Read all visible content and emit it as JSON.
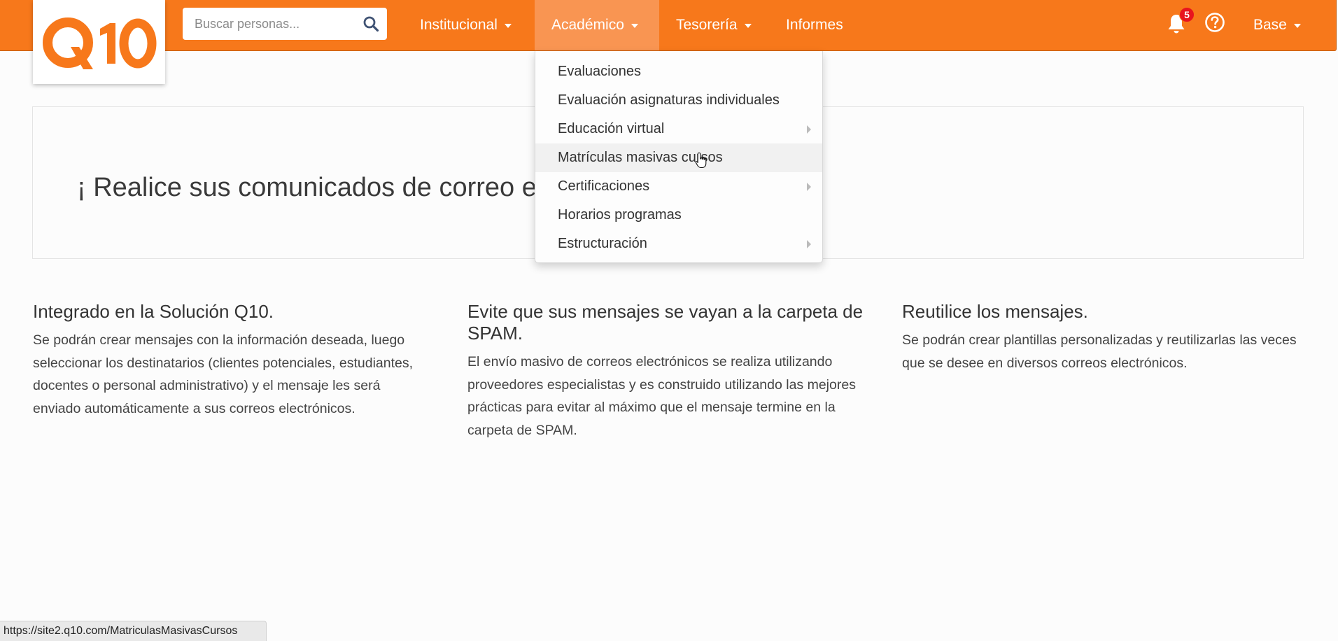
{
  "brand": {
    "logo_text": "Q10",
    "accent": "#f7781b",
    "hover_nav": "#f99552"
  },
  "search": {
    "placeholder": "Buscar personas...",
    "icon": "search-icon"
  },
  "nav": {
    "items": [
      {
        "label": "Institucional",
        "has_caret": true
      },
      {
        "label": "Académico",
        "has_caret": true,
        "active": true
      },
      {
        "label": "Tesorería",
        "has_caret": true
      },
      {
        "label": "Informes",
        "has_caret": false
      }
    ],
    "notifications": {
      "icon": "bell-icon",
      "count": "5"
    },
    "help_icon": "question-circle-icon",
    "user_label": "Base"
  },
  "dropdown": {
    "items": [
      {
        "label": "Evaluaciones",
        "submenu": false
      },
      {
        "label": "Evaluación asignaturas individuales",
        "submenu": false
      },
      {
        "label": "Educación virtual",
        "submenu": true
      },
      {
        "label": "Matrículas masivas cursos",
        "submenu": false,
        "hovered": true
      },
      {
        "label": "Certificaciones",
        "submenu": true
      },
      {
        "label": "Horarios programas",
        "submenu": false
      },
      {
        "label": "Estructuración",
        "submenu": true
      }
    ]
  },
  "hero": {
    "text": "¡ Realice sus comunicados de correo ele"
  },
  "features": [
    {
      "title": "Integrado en la Solución Q10.",
      "body": "Se podrán crear mensajes con la información deseada, luego seleccionar los destinatarios (clientes potenciales, estudiantes, docentes o personal administrativo) y el mensaje les será enviado automáticamente a sus correos electrónicos."
    },
    {
      "title": "Evite que sus mensajes se vayan a la carpeta de SPAM.",
      "body": "El envío masivo de correos electrónicos se realiza utilizando proveedores especialistas y es construido utilizando las mejores prácticas para evitar al máximo que el mensaje termine en la carpeta de SPAM."
    },
    {
      "title": "Reutilice los mensajes.",
      "body": "Se podrán crear plantillas personalizadas y reutilizarlas las veces que se desee en diversos correos electrónicos."
    }
  ],
  "status_bar": {
    "url": "https://site2.q10.com/MatriculasMasivasCursos"
  }
}
